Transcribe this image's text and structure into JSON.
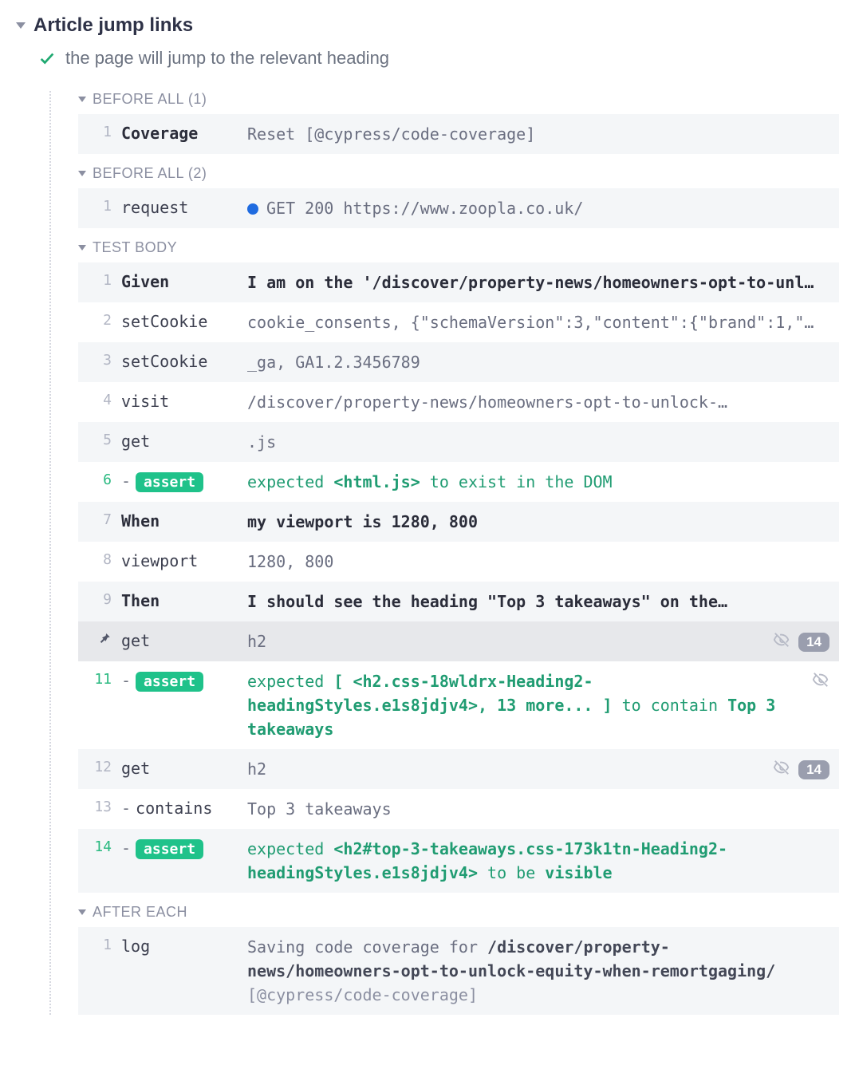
{
  "suite": {
    "title": "Article jump links"
  },
  "test": {
    "title": "the page will jump to the relevant heading"
  },
  "sections": {
    "beforeAll1": "BEFORE ALL (1)",
    "beforeAll2": "BEFORE ALL (2)",
    "testBody": "TEST BODY",
    "afterEach": "AFTER EACH"
  },
  "beforeAll1": {
    "rows": [
      {
        "num": "1",
        "name": "Coverage",
        "msg": "Reset [@cypress/code-coverage]"
      }
    ]
  },
  "beforeAll2": {
    "rows": [
      {
        "num": "1",
        "name": "request",
        "msg_prefix": "GET 200 ",
        "msg_url": "https://www.zoopla.co.uk/"
      }
    ]
  },
  "testBody": {
    "rows": [
      {
        "num": "1",
        "name": "Given",
        "bold": true,
        "msg": "I am on the '/discover/property-news/homeowners-opt-to-unl…"
      },
      {
        "num": "2",
        "name": "setCookie",
        "msg": "cookie_consents, {\"schemaVersion\":3,\"content\":{\"brand\":1,\"…"
      },
      {
        "num": "3",
        "name": "setCookie",
        "msg": "_ga, GA1.2.3456789"
      },
      {
        "num": "4",
        "name": "visit",
        "msg": "/discover/property-news/homeowners-opt-to-unlock-…"
      },
      {
        "num": "5",
        "name": "get",
        "msg": ".js"
      },
      {
        "num": "6",
        "assert": true,
        "msg_parts": {
          "p1": "expected ",
          "el": "<html.js>",
          "p2": " to exist in the DOM"
        }
      },
      {
        "num": "7",
        "name": "When",
        "bold": true,
        "msg": "my viewport is 1280, 800"
      },
      {
        "num": "8",
        "name": "viewport",
        "msg": "1280, 800"
      },
      {
        "num": "9",
        "name": "Then",
        "bold": true,
        "msg": "I should see the heading \"Top 3 takeaways\" on the…"
      },
      {
        "pin": true,
        "name": "get",
        "msg": "h2",
        "eye": true,
        "count": "14"
      },
      {
        "num": "11",
        "assert": true,
        "eye": true,
        "msg_parts": {
          "p1": "expected ",
          "el": "[ <h2.css-18wldrx-Heading2-headingStyles.e1s8jdjv4>, 13 more... ]",
          "p2": " to contain ",
          "v": "Top 3 takeaways"
        }
      },
      {
        "num": "12",
        "name": "get",
        "msg": "h2",
        "eye": true,
        "count": "14"
      },
      {
        "num": "13",
        "name": "contains",
        "dash": true,
        "msg": "Top 3 takeaways"
      },
      {
        "num": "14",
        "assert": true,
        "msg_parts": {
          "p1": "expected ",
          "el": "<h2#top-3-takeaways.css-173k1tn-Heading2-headingStyles.e1s8jdjv4>",
          "p2": " to be ",
          "v": "visible"
        }
      }
    ]
  },
  "afterEach": {
    "rows": [
      {
        "num": "1",
        "name": "log",
        "msg_pre": "Saving code coverage for ",
        "msg_strong": "/discover/property-news/homeowners-opt-to-unlock-equity-when-remortgaging/",
        "msg_tag": " [@cypress/code-coverage]"
      }
    ]
  },
  "labels": {
    "assert": "assert"
  }
}
